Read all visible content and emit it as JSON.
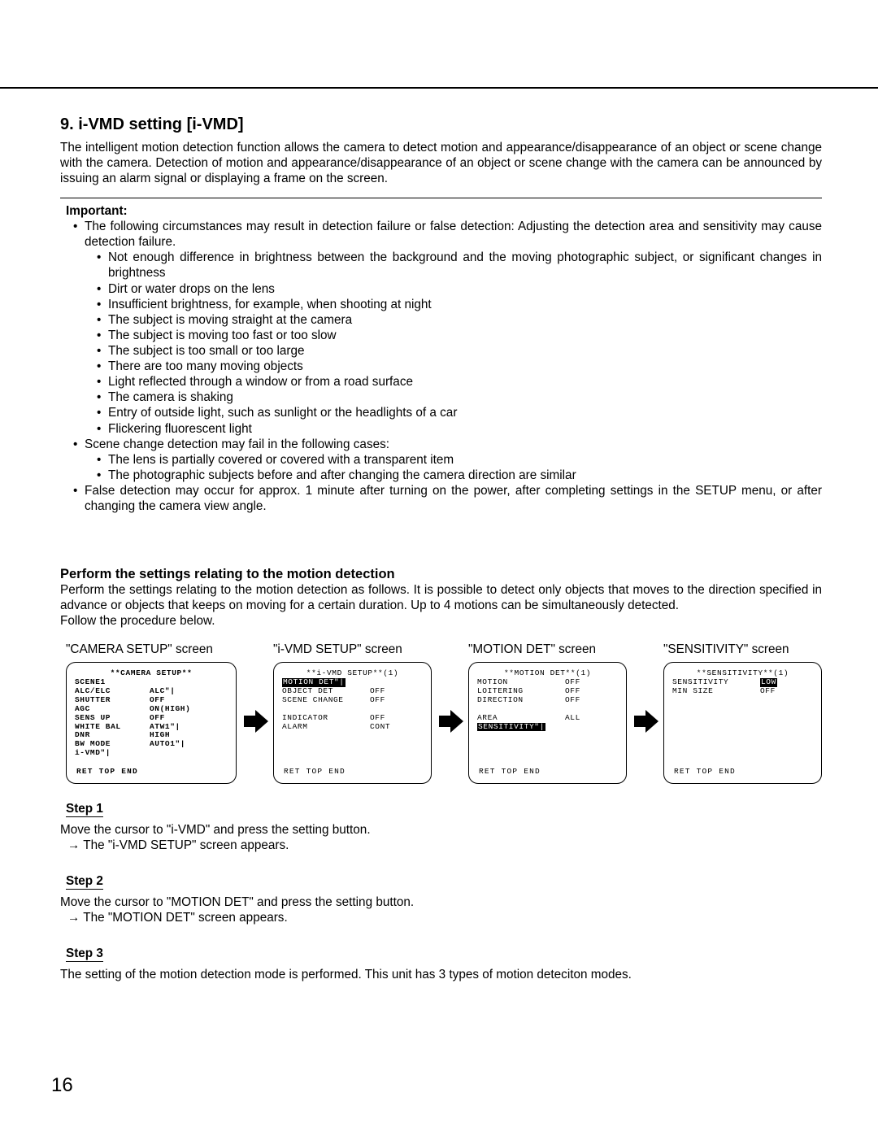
{
  "page_number": "16",
  "section_heading": "9. i-VMD setting [i-VMD]",
  "intro_text": "The intelligent motion detection function allows the camera to detect motion and appearance/disappearance of an object or scene change with the camera. Detection of motion and appearance/disappearance of an object or scene change with the camera can be announced by issuing an alarm signal or displaying a frame on the screen.",
  "important_label": "Important:",
  "bullets": {
    "b1": "The following circumstances may result in detection failure or false detection: Adjusting the detection area and sensitivity may cause detection failure.",
    "b1s": {
      "a": "Not enough difference in brightness between the background and the moving photographic subject, or significant changes in brightness",
      "b": "Dirt or water drops on the lens",
      "c": "Insufficient brightness, for example, when shooting at night",
      "d": "The subject is moving straight at the camera",
      "e": "The subject is moving too fast or too slow",
      "f": "The subject is too small or too large",
      "g": "There are too many moving objects",
      "h": "Light reflected through a window or from a road surface",
      "i": "The camera is shaking",
      "j": "Entry of outside light, such as sunlight or the headlights of a car",
      "k": "Flickering fluorescent light"
    },
    "b2": "Scene change detection may fail in the following cases:",
    "b2s": {
      "a": "The lens is partially covered or covered with a transparent item",
      "b": "The photographic subjects before and after changing the camera direction are similar"
    },
    "b3": "False detection may occur for approx. 1 minute after turning on the power, after completing settings in the SETUP menu, or after changing the camera view angle."
  },
  "sub_heading": "Perform the settings relating to the motion detection",
  "sub_text_1": "Perform the settings relating to the motion detection as follows. It is possible to detect only objects that moves to the direction specified in advance or objects that keeps on moving for a certain duration. Up to 4 motions can be simultaneously detected.",
  "sub_text_2": "Follow the procedure below.",
  "screens": {
    "s1": {
      "label": "\"CAMERA SETUP\" screen",
      "title": "**CAMERA SETUP**",
      "rows": [
        {
          "c1": "SCENE1",
          "c2": ""
        },
        {
          "c1": " ALC/ELC",
          "c2": "ALC\"|"
        },
        {
          "c1": " SHUTTER",
          "c2": "OFF"
        },
        {
          "c1": " AGC",
          "c2": "ON(HIGH)"
        },
        {
          "c1": " SENS UP",
          "c2": "OFF"
        },
        {
          "c1": " WHITE BAL",
          "c2": "ATW1\"|"
        },
        {
          "c1": " DNR",
          "c2": "HIGH"
        },
        {
          "c1": " BW MODE",
          "c2": "AUTO1\"|"
        },
        {
          "c1": " i-VMD\"|",
          "c2": ""
        }
      ],
      "footer": "RET TOP END"
    },
    "s2": {
      "label": "\"i-VMD SETUP\" screen",
      "title": "**i-VMD SETUP**(1)",
      "rows": [
        {
          "c1": "MOTION DET\"|",
          "c2": "",
          "hl": true
        },
        {
          "c1": "OBJECT DET",
          "c2": "OFF"
        },
        {
          "c1": "SCENE CHANGE",
          "c2": "OFF"
        },
        {
          "c1": "",
          "c2": ""
        },
        {
          "c1": "INDICATOR",
          "c2": "OFF"
        },
        {
          "c1": "ALARM",
          "c2": "CONT"
        }
      ],
      "footer": "RET TOP END"
    },
    "s3": {
      "label": "\"MOTION DET\" screen",
      "title": "**MOTION DET**(1)",
      "rows": [
        {
          "c1": "MOTION",
          "c2": "OFF"
        },
        {
          "c1": "LOITERING",
          "c2": "OFF"
        },
        {
          "c1": "DIRECTION",
          "c2": "OFF"
        },
        {
          "c1": "",
          "c2": ""
        },
        {
          "c1": "AREA",
          "c2": "ALL"
        },
        {
          "c1": "SENSITIVITY\"|",
          "c2": "",
          "hl": true
        }
      ],
      "footer": "RET TOP END"
    },
    "s4": {
      "label": "\"SENSITIVITY\" screen",
      "title": "**SENSITIVITY**(1)",
      "rows": [
        {
          "c1": "SENSITIVITY",
          "c2": "LOW",
          "hl2": true
        },
        {
          "c1": "MIN SIZE",
          "c2": "OFF"
        }
      ],
      "footer": "RET TOP END"
    }
  },
  "steps": {
    "s1": {
      "label": "Step 1",
      "line1": "Move the cursor to \"i-VMD\" and press the setting button.",
      "line2": "→ The \"i-VMD SETUP\" screen appears."
    },
    "s2": {
      "label": "Step 2",
      "line1": "Move the cursor to \"MOTION DET\" and press the setting button.",
      "line2": "→ The \"MOTION DET\" screen appears."
    },
    "s3": {
      "label": "Step 3",
      "line1": "The setting of the motion detection mode is performed. This unit has 3 types of motion deteciton modes."
    }
  }
}
